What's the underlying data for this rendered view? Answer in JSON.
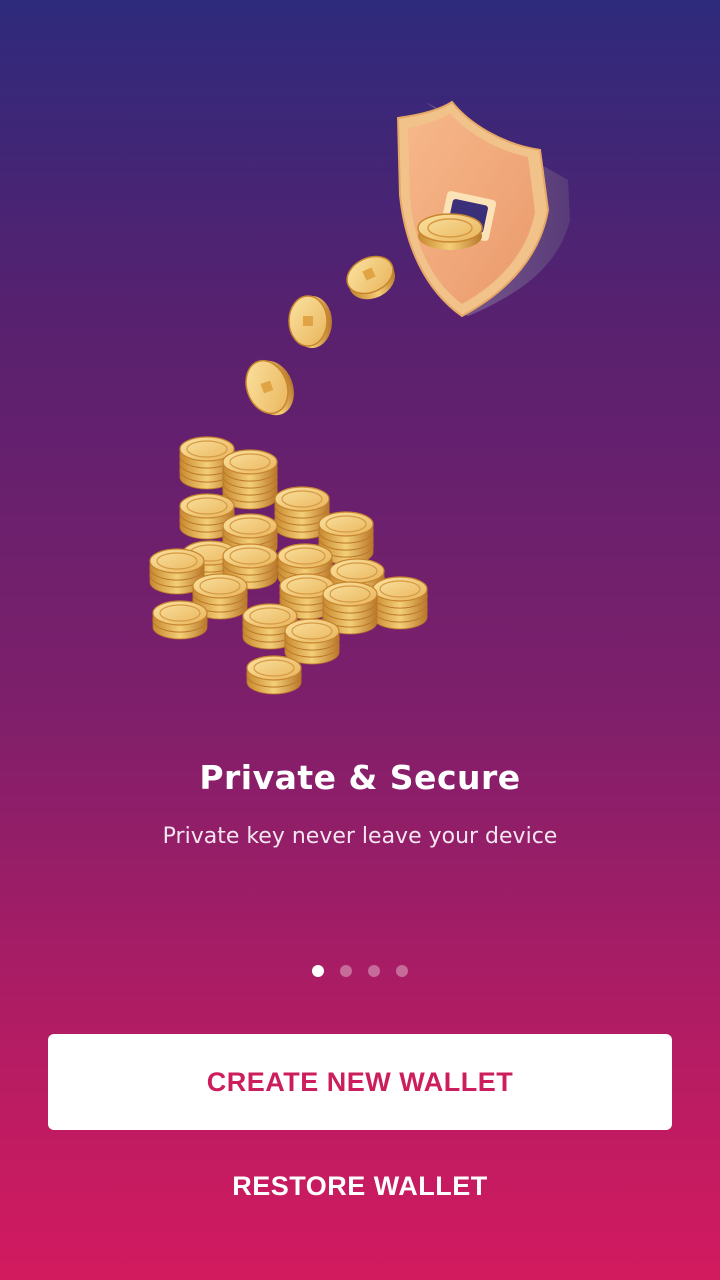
{
  "onboarding": {
    "title": "Private & Secure",
    "subtitle": "Private key never leave your device",
    "page_indicator": {
      "total": 4,
      "active": 1
    }
  },
  "actions": {
    "create_label": "CREATE NEW WALLET",
    "restore_label": "RESTORE WALLET"
  },
  "colors": {
    "gradient_top": "#2e2a7c",
    "gradient_bottom": "#d31a5f",
    "accent": "#cc1e5c",
    "coin_gold": "#f2c66a",
    "shield": "#f2a57a"
  },
  "illustration": {
    "icon": "shield-coins-illustration"
  }
}
